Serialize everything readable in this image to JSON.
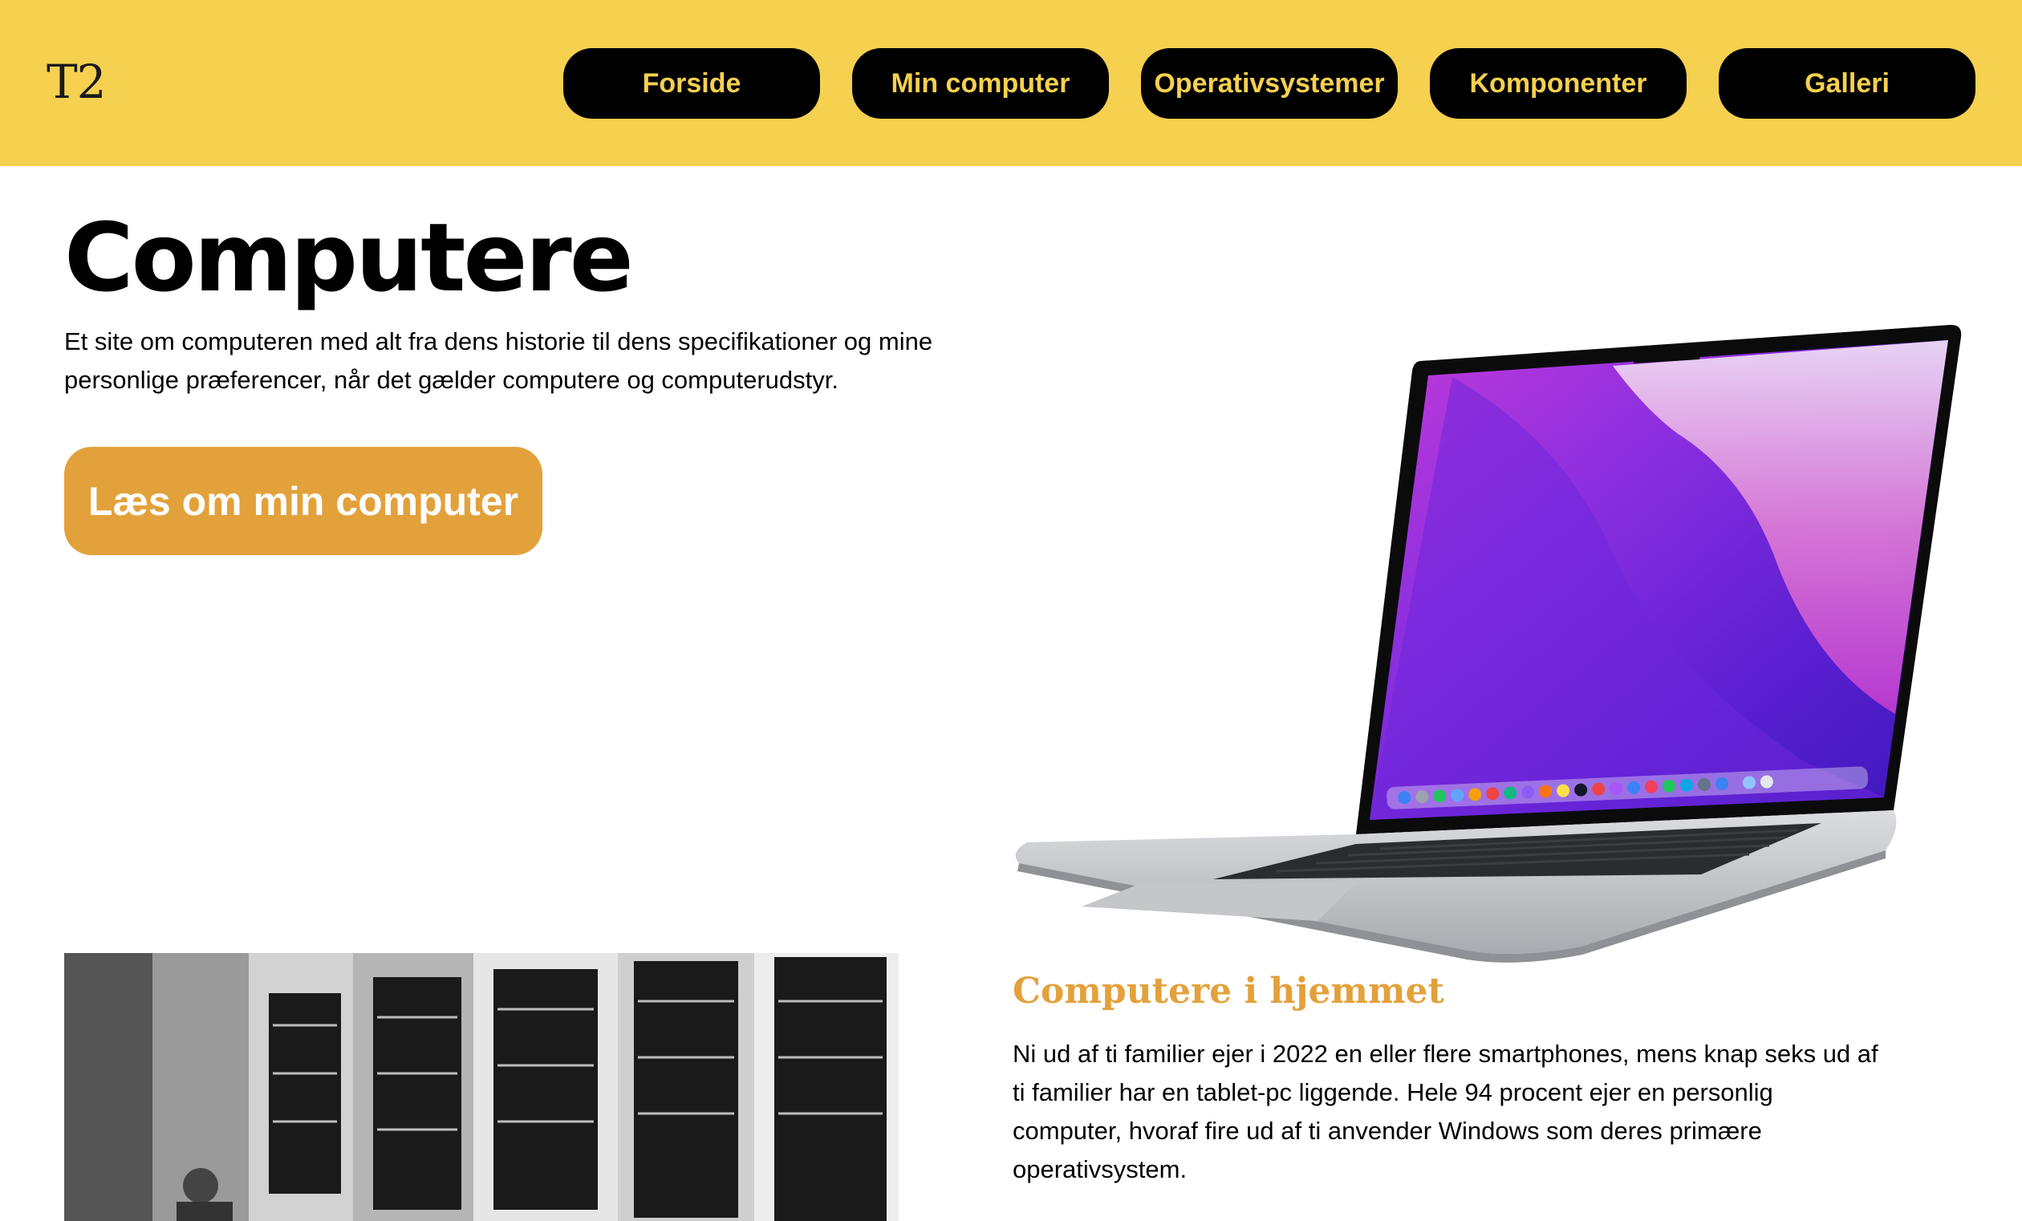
{
  "header": {
    "logo": "T2",
    "nav": [
      "Forside",
      "Min computer",
      "Operativsystemer",
      "Komponenter",
      "Galleri"
    ]
  },
  "hero": {
    "title": "Computere",
    "description": "Et site om computeren med alt fra dens historie til dens specifikationer og mine personlige præferencer, når det gælder computere og computerudstyr.",
    "cta": "Læs om min computer"
  },
  "section": {
    "title": "Computere i hjemmet",
    "text": "Ni ud af ti familier ejer i 2022 en eller flere smartphones, mens knap seks ud af ti familier har en tablet-pc liggende. Hele 94 procent ejer en personlig computer, hvoraf fire ud af ti anvender Windows som deres primære operativsystem."
  },
  "colors": {
    "header_bg": "#f6d04f",
    "nav_bg": "#000000",
    "nav_text": "#f6d04f",
    "accent": "#e3a13b"
  },
  "images": {
    "laptop": "laptop-image",
    "historic": "historic-computer-photo"
  }
}
